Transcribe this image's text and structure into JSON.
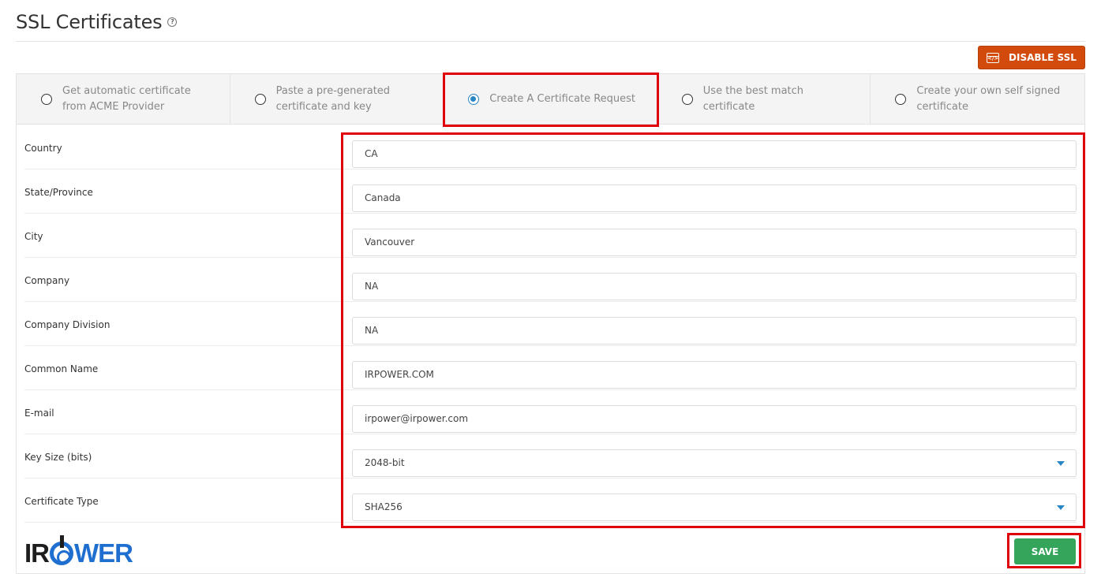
{
  "page": {
    "title": "SSL Certificates",
    "help_glyph": "?"
  },
  "toolbar": {
    "disable_label": "DISABLE SSL",
    "disable_icon_glyph": "</>"
  },
  "tabs": [
    {
      "label": "Get automatic certificate from ACME Provider",
      "selected": false
    },
    {
      "label": "Paste a pre-generated certificate and key",
      "selected": false
    },
    {
      "label": "Create A Certificate Request",
      "selected": true
    },
    {
      "label": "Use the best match certificate",
      "selected": false
    },
    {
      "label": "Create your own self signed certificate",
      "selected": false
    }
  ],
  "form": {
    "fields": [
      {
        "label": "Country",
        "value": "CA",
        "type": "text"
      },
      {
        "label": "State/Province",
        "value": "Canada",
        "type": "text"
      },
      {
        "label": "City",
        "value": "Vancouver",
        "type": "text"
      },
      {
        "label": "Company",
        "value": "NA",
        "type": "text"
      },
      {
        "label": "Company Division",
        "value": "NA",
        "type": "text"
      },
      {
        "label": "Common Name",
        "value": "IRPOWER.COM",
        "type": "text"
      },
      {
        "label": "E-mail",
        "value": "irpower@irpower.com",
        "type": "text"
      },
      {
        "label": "Key Size (bits)",
        "value": "2048-bit",
        "type": "select"
      },
      {
        "label": "Certificate Type",
        "value": "SHA256",
        "type": "select"
      }
    ]
  },
  "logo": {
    "text_left": "IR",
    "text_right": "WER"
  },
  "footer": {
    "save_label": "SAVE"
  },
  "colors": {
    "accent": "#2b86c5",
    "danger": "#d24a0c",
    "success": "#34a55a",
    "highlight": "#e0000a",
    "logo_blue": "#1f6fd1"
  }
}
